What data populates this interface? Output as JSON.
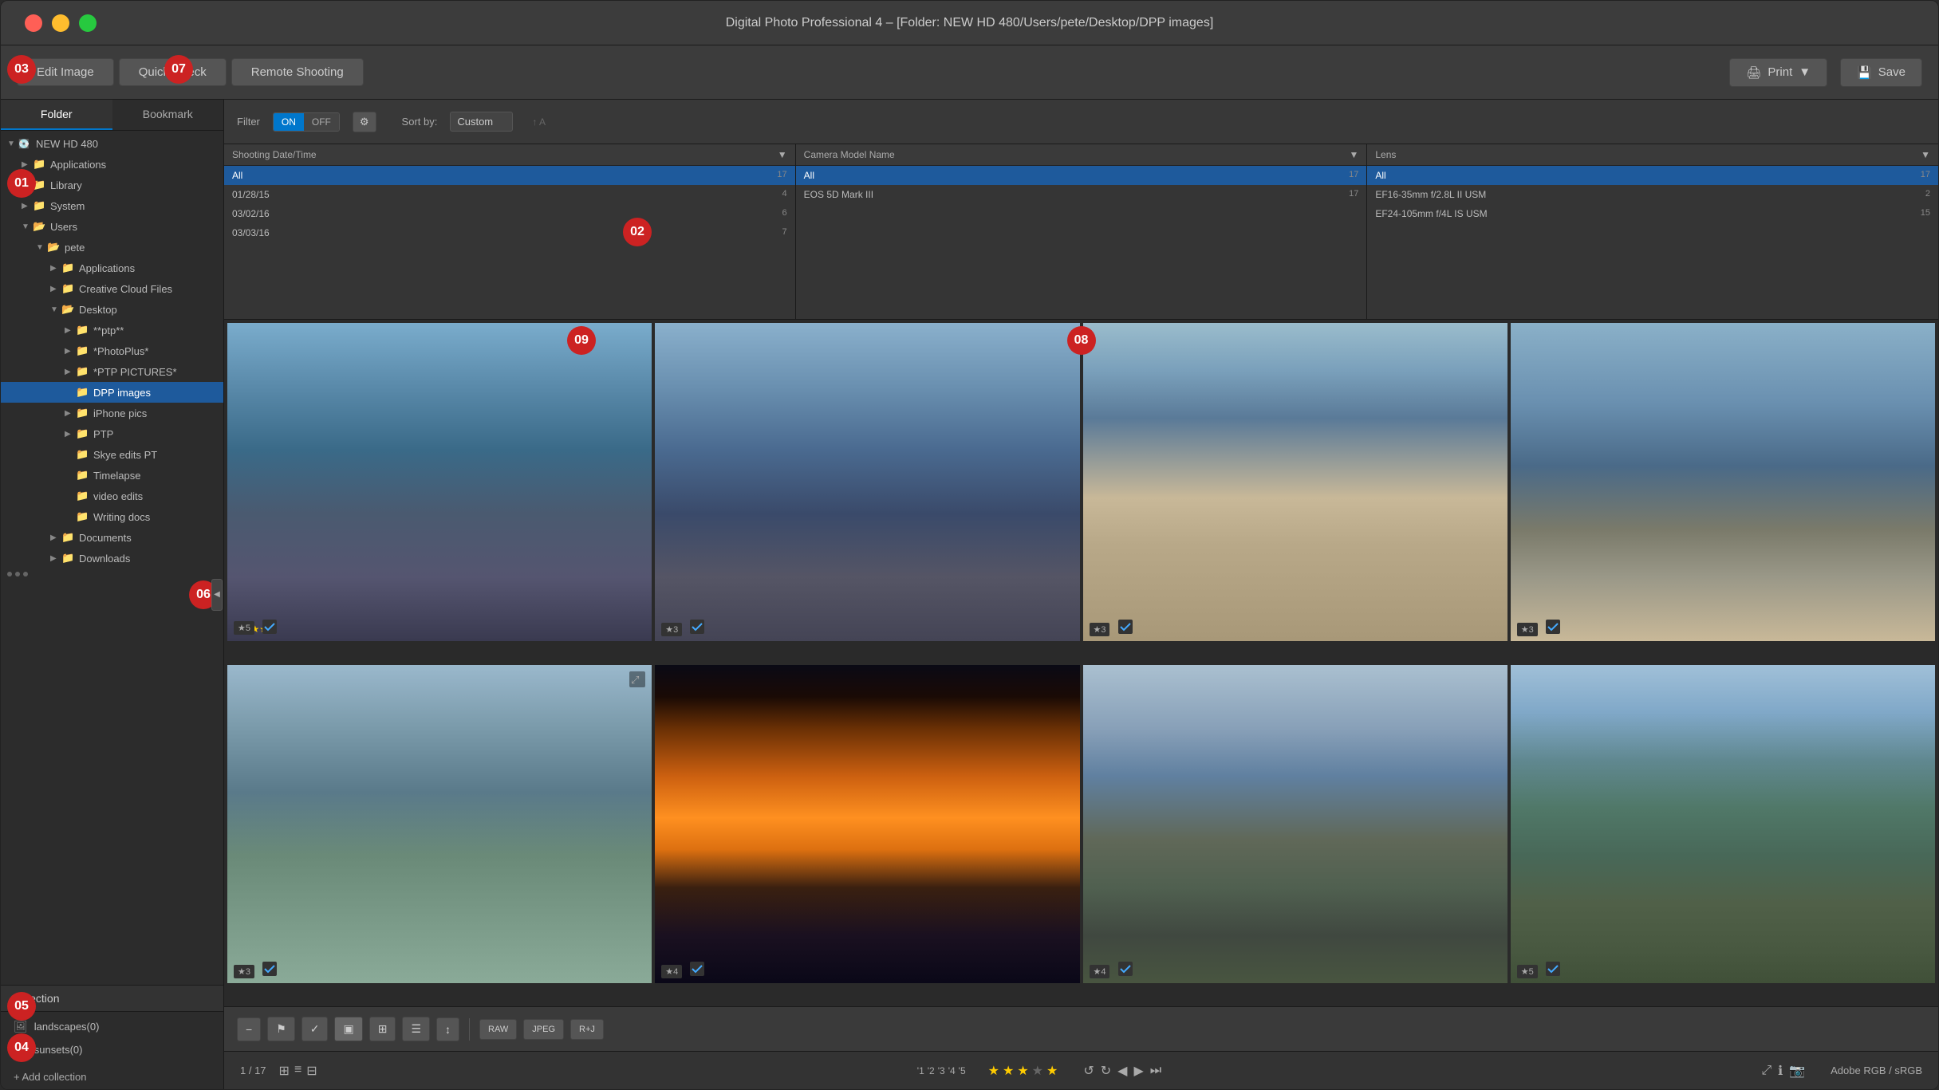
{
  "window": {
    "title": "Digital Photo Professional 4 – [Folder: NEW HD 480/Users/pete/Desktop/DPP images]"
  },
  "toolbar": {
    "edit_image": "Edit Image",
    "quick_check": "Quick Check",
    "remote_shooting": "Remote Shooting",
    "print": "Print",
    "save": "Save"
  },
  "sidebar": {
    "tab_folder": "Folder",
    "tab_bookmark": "Bookmark",
    "tree": [
      {
        "label": "NEW HD 480",
        "level": 0,
        "type": "hd",
        "expanded": true
      },
      {
        "label": "Applications",
        "level": 1,
        "type": "folder",
        "expanded": false
      },
      {
        "label": "Library",
        "level": 1,
        "type": "folder",
        "expanded": false
      },
      {
        "label": "System",
        "level": 1,
        "type": "folder",
        "expanded": false
      },
      {
        "label": "Users",
        "level": 1,
        "type": "folder",
        "expanded": true
      },
      {
        "label": "pete",
        "level": 2,
        "type": "folder",
        "expanded": true
      },
      {
        "label": "Applications",
        "level": 3,
        "type": "folder",
        "expanded": false
      },
      {
        "label": "Creative Cloud Files",
        "level": 3,
        "type": "folder",
        "expanded": false
      },
      {
        "label": "Desktop",
        "level": 3,
        "type": "folder",
        "expanded": true
      },
      {
        "label": "**ptp**",
        "level": 4,
        "type": "folder",
        "expanded": false
      },
      {
        "label": "*PhotoPlus*",
        "level": 4,
        "type": "folder",
        "expanded": false
      },
      {
        "label": "*PTP PICTURES*",
        "level": 4,
        "type": "folder",
        "expanded": false
      },
      {
        "label": "DPP images",
        "level": 4,
        "type": "folder",
        "expanded": false,
        "selected": true
      },
      {
        "label": "iPhone pics",
        "level": 4,
        "type": "folder",
        "expanded": false
      },
      {
        "label": "PTP",
        "level": 4,
        "type": "folder",
        "expanded": false
      },
      {
        "label": "Skye edits PT",
        "level": 4,
        "type": "folder",
        "expanded": false
      },
      {
        "label": "Timelapse",
        "level": 4,
        "type": "folder",
        "expanded": false
      },
      {
        "label": "video edits",
        "level": 4,
        "type": "folder",
        "expanded": false
      },
      {
        "label": "Writing docs",
        "level": 4,
        "type": "folder",
        "expanded": false
      },
      {
        "label": "Documents",
        "level": 3,
        "type": "folder",
        "expanded": false
      },
      {
        "label": "Downloads",
        "level": 3,
        "type": "folder",
        "expanded": false
      }
    ],
    "collection_header": "Collection",
    "collections": [
      {
        "label": "landscapes(0)"
      },
      {
        "label": "sunsets(0)"
      }
    ],
    "add_collection": "+ Add collection"
  },
  "filter": {
    "label": "Filter",
    "on": "ON",
    "off": "OFF",
    "sort_label": "Sort by:",
    "sort_value": "Custom"
  },
  "metadata": {
    "shooting_date": {
      "header": "Shooting Date/Time",
      "items": [
        {
          "label": "All",
          "count": 17
        },
        {
          "label": "01/28/15",
          "count": 4
        },
        {
          "label": "03/02/16",
          "count": 6
        },
        {
          "label": "03/03/16",
          "count": 7
        }
      ]
    },
    "camera_model": {
      "header": "Camera Model Name",
      "items": [
        {
          "label": "All",
          "count": 17
        },
        {
          "label": "EOS 5D Mark III",
          "count": 17
        }
      ]
    },
    "lens": {
      "header": "Lens",
      "items": [
        {
          "label": "All",
          "count": 17
        },
        {
          "label": "EF16-35mm f/2.8L II USM",
          "count": 2
        },
        {
          "label": "EF24-105mm f/4L IS USM",
          "count": 15
        }
      ]
    }
  },
  "photos": [
    {
      "id": 1,
      "stars": 5,
      "style": "castle1",
      "has_check": true
    },
    {
      "id": 2,
      "stars": 3,
      "style": "castle2",
      "has_check": true
    },
    {
      "id": 3,
      "stars": 3,
      "style": "beach1",
      "has_check": true
    },
    {
      "id": 4,
      "stars": 3,
      "style": "coast",
      "has_check": true
    },
    {
      "id": 5,
      "stars": 3,
      "style": "harbor",
      "has_check": true,
      "has_zoom": true
    },
    {
      "id": 6,
      "stars": 4,
      "style": "sunset",
      "has_check": true
    },
    {
      "id": 7,
      "stars": 4,
      "style": "ruins1",
      "has_check": true
    },
    {
      "id": 8,
      "stars": 5,
      "style": "ruins2",
      "has_check": true
    }
  ],
  "status": {
    "count": "1 / 17",
    "color_profile": "Adobe RGB / sRGB",
    "rating_labels": [
      "1",
      "2",
      "3",
      "4",
      "5"
    ],
    "active_rating": 3
  },
  "annotations": {
    "numbers": [
      "07",
      "02",
      "03",
      "01",
      "06",
      "04",
      "05",
      "09",
      "08"
    ]
  }
}
